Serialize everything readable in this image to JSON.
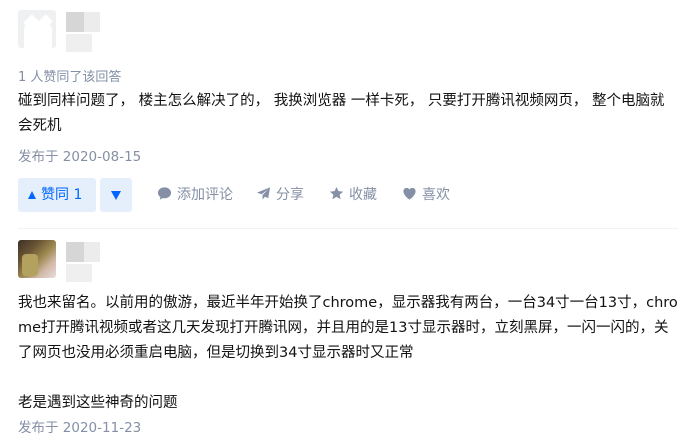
{
  "answers": [
    {
      "votes_note": "1 人赞同了该回答",
      "content": "碰到同样问题了， 楼主怎么解决了的， 我换浏览器 一样卡死， 只要打开腾讯视频网页， 整个电脑就会死机",
      "date": "发布于 2020-08-15",
      "actions": {
        "vote_up": "赞同 1",
        "comment": "添加评论",
        "share": "分享",
        "favorite": "收藏",
        "like": "喜欢"
      }
    },
    {
      "content": "我也来留名。以前用的傲游，最近半年开始换了chrome，显示器我有两台，一台34寸一台13寸，chrome打开腾讯视频或者这几天发现打开腾讯网，并且用的是13寸显示器时，立刻黑屏，一闪一闪的，关了网页也没用必须重启电脑，但是切换到34寸显示器时又正常\n\n老是遇到这些神奇的问题",
      "date": "发布于 2020-11-23"
    }
  ],
  "colors": {
    "accent": "#0066ff",
    "vote_bg": "#e5eefb",
    "meta_text": "#8590a6",
    "body_text": "#121212"
  },
  "icons": {
    "comment": "comment-bubble-icon",
    "share": "paper-plane-share-icon",
    "favorite": "star-icon",
    "like": "heart-icon"
  }
}
